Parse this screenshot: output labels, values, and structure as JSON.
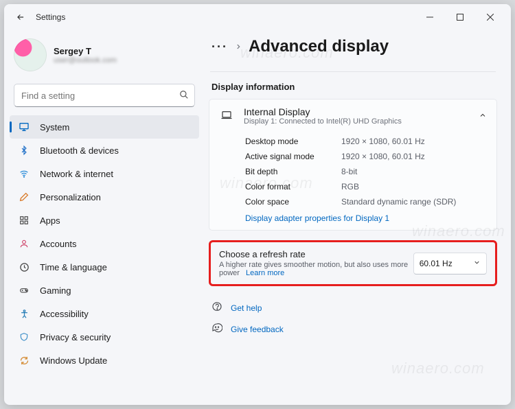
{
  "window": {
    "app_title": "Settings"
  },
  "profile": {
    "name": "Sergey T",
    "email": "user@outlook.com"
  },
  "search": {
    "placeholder": "Find a setting"
  },
  "sidebar": {
    "items": [
      {
        "label": "System",
        "icon": "monitor-icon",
        "active": true
      },
      {
        "label": "Bluetooth & devices",
        "icon": "bluetooth-icon"
      },
      {
        "label": "Network & internet",
        "icon": "wifi-icon"
      },
      {
        "label": "Personalization",
        "icon": "paint-icon"
      },
      {
        "label": "Apps",
        "icon": "apps-icon"
      },
      {
        "label": "Accounts",
        "icon": "person-icon"
      },
      {
        "label": "Time & language",
        "icon": "clock-icon"
      },
      {
        "label": "Gaming",
        "icon": "game-icon"
      },
      {
        "label": "Accessibility",
        "icon": "accessibility-icon"
      },
      {
        "label": "Privacy & security",
        "icon": "shield-icon"
      },
      {
        "label": "Windows Update",
        "icon": "update-icon"
      }
    ]
  },
  "breadcrumb": {
    "ellipsis": "···",
    "page_title": "Advanced display"
  },
  "section": {
    "title": "Display information"
  },
  "card": {
    "title": "Internal Display",
    "subtitle": "Display 1: Connected to Intel(R) UHD Graphics",
    "rows": [
      {
        "k": "Desktop mode",
        "v": "1920 × 1080, 60.01 Hz"
      },
      {
        "k": "Active signal mode",
        "v": "1920 × 1080, 60.01 Hz"
      },
      {
        "k": "Bit depth",
        "v": "8-bit"
      },
      {
        "k": "Color format",
        "v": "RGB"
      },
      {
        "k": "Color space",
        "v": "Standard dynamic range (SDR)"
      }
    ],
    "adapter_link": "Display adapter properties for Display 1"
  },
  "refresh": {
    "title": "Choose a refresh rate",
    "subtitle": "A higher rate gives smoother motion, but also uses more power",
    "learn_more": "Learn more",
    "selected": "60.01 Hz"
  },
  "footer": {
    "help": "Get help",
    "feedback": "Give feedback"
  },
  "watermark": "winaero.com"
}
